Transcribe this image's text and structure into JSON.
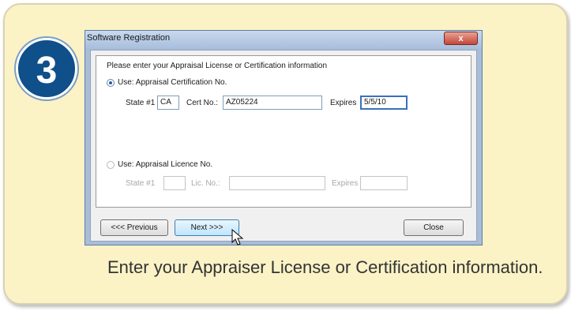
{
  "step": {
    "number": "3"
  },
  "window": {
    "title": "Software Registration",
    "close_glyph": "x",
    "prompt": "Please enter your Appraisal License or Certification information",
    "certification": {
      "option_label": "Use:  Appraisal Certification No.",
      "selected": true,
      "state_label": "State #1",
      "state_value": "CA",
      "cert_label": "Cert No.:",
      "cert_value": "AZ05224",
      "expires_label": "Expires",
      "expires_value": "5/5/10"
    },
    "license": {
      "option_label": "Use:  Appraisal Licence No.",
      "selected": false,
      "state_label": "State #1",
      "state_value": "",
      "lic_label": "Lic. No.:",
      "lic_value": "",
      "expires_label": "Expires",
      "expires_value": ""
    },
    "buttons": {
      "previous": "<<< Previous",
      "next": "Next >>>",
      "close": "Close"
    }
  },
  "caption": "Enter your Appraiser License or Certification information.",
  "colors": {
    "card_bg": "#fbf2c6",
    "badge_bg": "#0f4f8a",
    "window_frame": "#aabdd7",
    "close_button": "#c4463a",
    "selected_radio": "#1f5fa8"
  },
  "icons": {
    "cursor": "mouse-pointer-icon"
  }
}
